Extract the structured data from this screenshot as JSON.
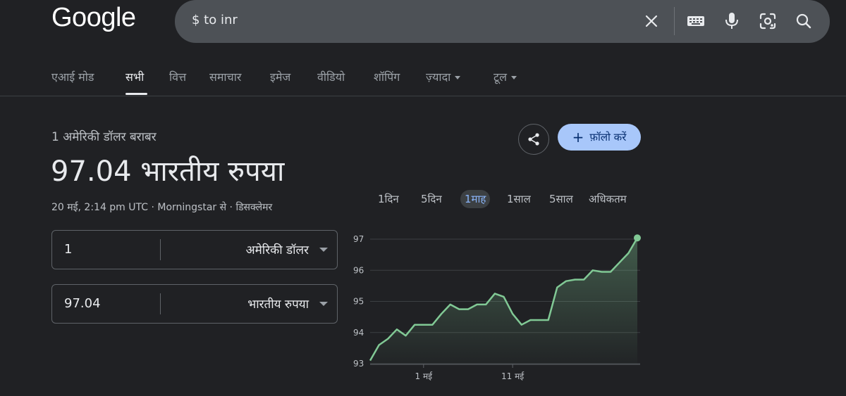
{
  "header": {
    "logo": "Google",
    "search_query": "$ to inr",
    "icons": [
      "close-icon",
      "keyboard-icon",
      "mic-icon",
      "lens-icon",
      "search-icon"
    ]
  },
  "nav": {
    "items": [
      {
        "label": "एआई मोड",
        "active": false
      },
      {
        "label": "सभी",
        "active": true
      },
      {
        "label": "वित्त",
        "active": false
      },
      {
        "label": "समाचार",
        "active": false
      },
      {
        "label": "इमेज",
        "active": false
      },
      {
        "label": "वीडियो",
        "active": false
      },
      {
        "label": "शॉपिंग",
        "active": false
      },
      {
        "label": "ज़्यादा",
        "active": false
      },
      {
        "label": "टूल",
        "active": false
      }
    ]
  },
  "result": {
    "subtitle": "1 अमेरिकी डॉलर बराबर",
    "value": "97.04 भारतीय रुपया",
    "meta": "20 मई, 2:14 pm UTC · Morningstar से · डिसक्लेमर"
  },
  "converter": {
    "from": {
      "amount": "1",
      "unit": "अमेरिकी डॉलर"
    },
    "to": {
      "amount": "97.04",
      "unit": "भारतीय रुपया"
    }
  },
  "actions": {
    "follow_label": "फ़ॉलो करें",
    "share_icon": "share-icon"
  },
  "ranges": {
    "items": [
      "1दिन",
      "5दिन",
      "1माह",
      "1साल",
      "5साल",
      "अधिकतम"
    ],
    "active": "1माह"
  },
  "colors": {
    "background": "#202124",
    "search_box": "#4d5156",
    "line": "#81c995",
    "follow_button": "#a8c7fa",
    "active_tab": "#8ab4f8"
  },
  "chart_data": {
    "type": "area",
    "x_tick_labels": [
      "1 मई",
      "11 मई"
    ],
    "ylim": [
      93,
      97
    ],
    "y_ticks": [
      93,
      94,
      95,
      96,
      97
    ],
    "grid": true,
    "values": [
      93.1,
      93.6,
      93.8,
      94.1,
      93.9,
      94.25,
      94.25,
      94.25,
      94.6,
      94.9,
      94.75,
      94.75,
      94.9,
      94.9,
      95.25,
      95.15,
      94.6,
      94.25,
      94.4,
      94.4,
      94.4,
      95.45,
      95.65,
      95.7,
      95.7,
      96.0,
      95.95,
      95.95,
      96.25,
      96.55,
      97.04
    ]
  }
}
